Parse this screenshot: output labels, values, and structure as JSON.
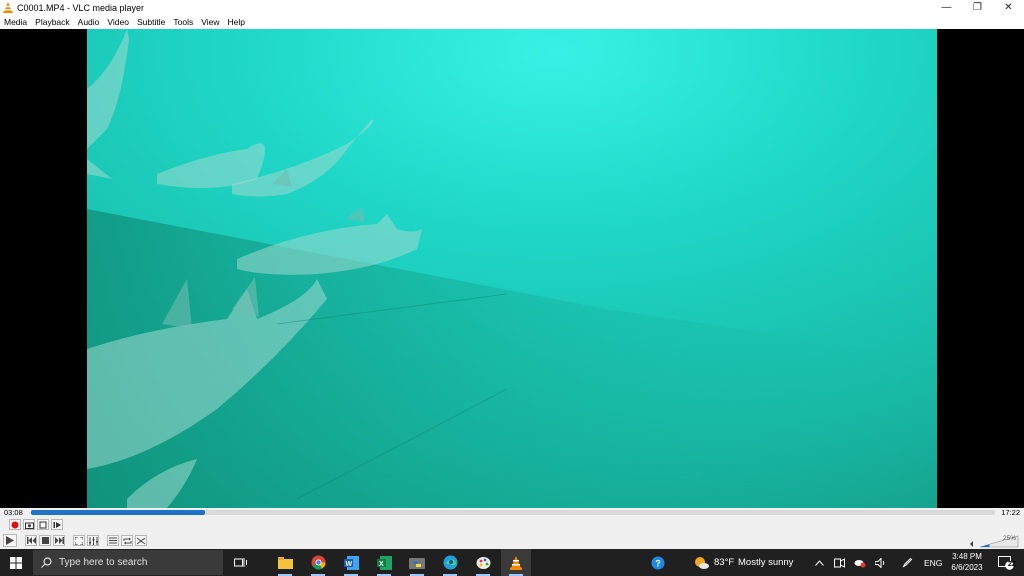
{
  "window": {
    "title": "C0001.MP4 - VLC media player",
    "minimize_glyph": "—",
    "maximize_glyph": "❐",
    "close_glyph": "✕"
  },
  "menu": [
    "Media",
    "Playback",
    "Audio",
    "Video",
    "Subtitle",
    "Tools",
    "View",
    "Help"
  ],
  "player": {
    "time_current": "03:08",
    "time_total": "17:22",
    "progress_fraction": 0.18,
    "volume_label": "25%",
    "volume_fraction": 0.25
  },
  "controls": {
    "row1": [
      "record-button",
      "snapshot-button",
      "loop-ab-button",
      "frame-by-frame-button"
    ],
    "row2": [
      "play-button",
      "previous-button",
      "stop-button",
      "next-button",
      "fullscreen-button",
      "extended-settings-button",
      "playlist-button",
      "loop-button",
      "shuffle-button"
    ]
  },
  "taskbar": {
    "search_placeholder": "Type here to search",
    "apps": [
      "task-view",
      "file-explorer",
      "chrome",
      "word",
      "excel",
      "python",
      "edge",
      "paint",
      "vlc"
    ],
    "weather_temp": "83°F",
    "weather_desc": "Mostly sunny",
    "language": "ENG",
    "time": "3:48 PM",
    "date": "6/6/2023",
    "notification_count": "22"
  },
  "colors": {
    "accent": "#1e73c8",
    "taskbar": "#202020",
    "water": "#1fd3c0"
  }
}
